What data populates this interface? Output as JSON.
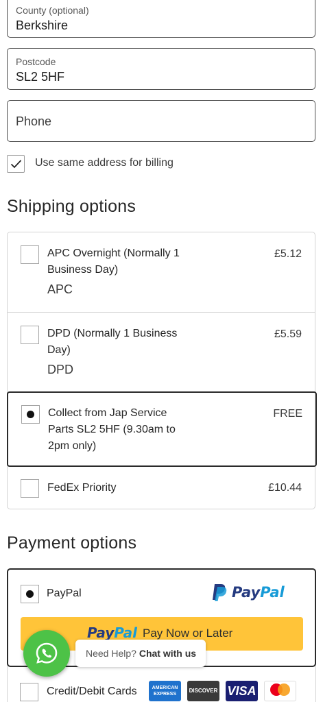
{
  "address": {
    "county": {
      "label": "County (optional)",
      "value": "Berkshire"
    },
    "postcode": {
      "label": "Postcode",
      "value": "SL2 5HF"
    },
    "phone": {
      "placeholder": "Phone"
    },
    "billing_same": {
      "label": "Use same address for billing",
      "checked": true
    }
  },
  "shipping": {
    "title": "Shipping options",
    "options": [
      {
        "name": "APC Overnight (Normally 1 Business Day)",
        "carrier": "APC",
        "price": "£5.12",
        "selected": false
      },
      {
        "name": "DPD (Normally 1 Business Day)",
        "carrier": "DPD",
        "price": "£5.59",
        "selected": false
      },
      {
        "name": "Collect from Jap Service Parts SL2 5HF (9.30am to 2pm only)",
        "carrier": "",
        "price": "FREE",
        "selected": true
      },
      {
        "name": "FedEx Priority",
        "carrier": "",
        "price": "£10.44",
        "selected": false
      }
    ]
  },
  "payment": {
    "title": "Payment options",
    "paypal": {
      "label": "PayPal",
      "logo_pay": "Pay",
      "logo_pal": "Pal",
      "button_brand_pay": "Pay",
      "button_brand_pal": "Pal",
      "button_text": "Pay Now or Later",
      "selected": true
    },
    "cards": {
      "label": "Credit/Debit Cards",
      "logos": [
        "American Express",
        "Discover",
        "Visa",
        "Mastercard"
      ]
    }
  },
  "chat": {
    "prefix": "Need Help?",
    "cta": "Chat with us",
    "icon": "whatsapp-icon"
  },
  "colors": {
    "paypal_yellow": "#ffc439",
    "paypal_dark": "#253b80",
    "paypal_light": "#179bd7",
    "whatsapp_green": "#4dc247"
  }
}
